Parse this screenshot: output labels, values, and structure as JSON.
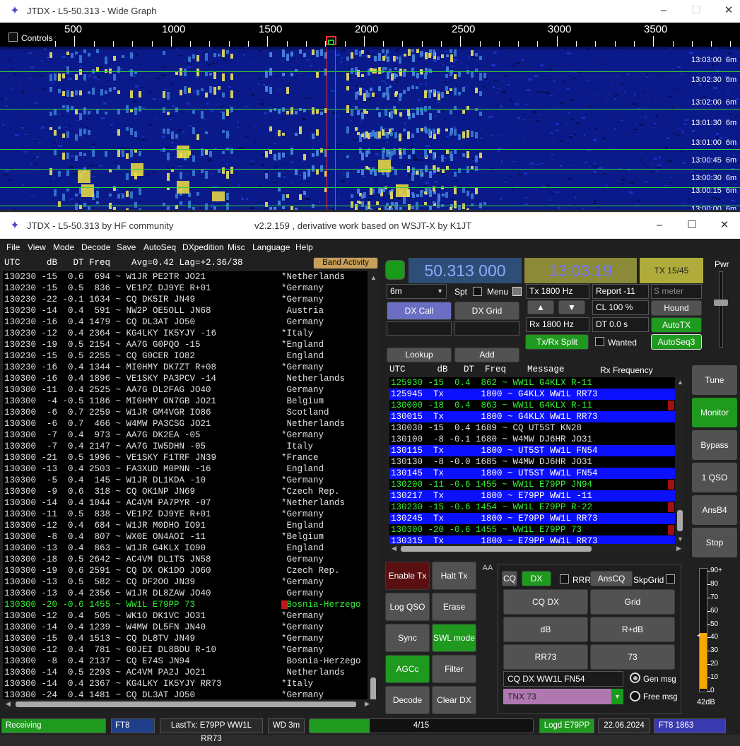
{
  "wide_graph": {
    "title": "JTDX - L5-50.313 - Wide Graph",
    "controls_label": "Controls",
    "scale_labels": [
      "500",
      "1000",
      "1500",
      "2000",
      "2500",
      "3000",
      "3500"
    ],
    "timestamps": [
      "13:03:00",
      "13:02:30",
      "13:02:00",
      "13:01:30",
      "13:01:00",
      "13:00:45",
      "13:00:30",
      "13:00:15",
      "13:00:00"
    ],
    "band_suffix": "6m"
  },
  "main_window": {
    "title": "JTDX - L5-50.313  by HF community",
    "subtitle": "v2.2.159 , derivative work based on WSJT-X by K1JT"
  },
  "menu": [
    "File",
    "View",
    "Mode",
    "Decode",
    "Save",
    "AutoSeq",
    "DXpedition",
    "Misc",
    "Language",
    "Help"
  ],
  "band_activity": {
    "header": "UTC     dB   DT Freq    Avg=0.42 Lag=+2.36/38",
    "button": "Band Activity",
    "rows": [
      {
        "t": "130230 -15  0.6  694 ~ W1JR PE2TR JO21",
        "c": "*Netherlands",
        "hl": false
      },
      {
        "t": "130230 -15  0.5  836 ~ VE1PZ DJ9YE R+01",
        "c": "*Germany",
        "hl": false
      },
      {
        "t": "130230 -22 -0.1 1634 ~ CQ DK5IR JN49",
        "c": "*Germany",
        "hl": false
      },
      {
        "t": "130230 -14  0.4  591 ~ NW2P OE5OLL JN68",
        "c": " Austria",
        "hl": false
      },
      {
        "t": "130230 -16  0.4 1479 ~ CQ DL3AT JO50",
        "c": " Germany",
        "hl": false
      },
      {
        "t": "130230 -12  0.4 2364 ~ KG4LKY IK5YJY -16",
        "c": "*Italy",
        "hl": false
      },
      {
        "t": "130230 -19  0.5 2154 ~ AA7G G0PQO -15",
        "c": "*England",
        "hl": false
      },
      {
        "t": "130230 -15  0.5 2255 ~ CQ G0CER IO82",
        "c": " England",
        "hl": false
      },
      {
        "t": "130230 -16  0.4 1344 ~ MI0HMY DK7ZT R+08",
        "c": "*Germany",
        "hl": false
      },
      {
        "t": "130300 -16  0.4 1896 ~ VE1SKY PA3PCV -14",
        "c": " Netherlands",
        "hl": false
      },
      {
        "t": "130300 -11  0.4 2525 ~ AA7G DL2FAG JO40",
        "c": " Germany",
        "hl": false
      },
      {
        "t": "130300  -4 -0.5 1186 ~ MI0HMY ON7GB JO21",
        "c": " Belgium",
        "hl": false
      },
      {
        "t": "130300  -6  0.7 2259 ~ W1JR GM4VGR IO86",
        "c": " Scotland",
        "hl": false
      },
      {
        "t": "130300  -6  0.7  466 ~ W4MW PA3CSG JO21",
        "c": " Netherlands",
        "hl": false
      },
      {
        "t": "130300  -7  0.4  973 ~ AA7G DK2EA -05",
        "c": "*Germany",
        "hl": false
      },
      {
        "t": "130300  -7  0.4 2147 ~ AA7G IW5DHN -05",
        "c": " Italy",
        "hl": false
      },
      {
        "t": "130300 -21  0.5 1996 ~ VE1SKY F1TRF JN39",
        "c": "*France",
        "hl": false
      },
      {
        "t": "130300 -13  0.4 2503 ~ FA3XUD M0PNN -16",
        "c": " England",
        "hl": false
      },
      {
        "t": "130300  -5  0.4  145 ~ W1JR DL1KDA -10",
        "c": "*Germany",
        "hl": false
      },
      {
        "t": "130300  -9  0.6  318 ~ CQ OK1NP JN69",
        "c": "*Czech Rep.",
        "hl": false
      },
      {
        "t": "130300 -14  0.4 1044 ~ AC4VM PA7PYR -07",
        "c": "*Netherlands",
        "hl": false
      },
      {
        "t": "130300 -11  0.5  838 ~ VE1PZ DJ9YE R+01",
        "c": "*Germany",
        "hl": false
      },
      {
        "t": "130300 -12  0.4  684 ~ W1JR M0DHO IO91",
        "c": " England",
        "hl": false
      },
      {
        "t": "130300  -8  0.4  807 ~ WX0E ON4AOI -11",
        "c": "*Belgium",
        "hl": false
      },
      {
        "t": "130300 -13  0.4  863 ~ W1JR G4KLX IO90",
        "c": " England",
        "hl": false
      },
      {
        "t": "130300 -18  0.5 2642 ~ AC4VM DL1TS JN58",
        "c": " Germany",
        "hl": false
      },
      {
        "t": "130300 -19  0.6 2591 ~ CQ DX OK1DO JO60",
        "c": " Czech Rep.",
        "hl": false
      },
      {
        "t": "130300 -13  0.5  582 ~ CQ DF2OO JN39",
        "c": "*Germany",
        "hl": false
      },
      {
        "t": "130300 -13  0.4 2356 ~ W1JR DL8ZAW JO40",
        "c": " Germany",
        "hl": false
      },
      {
        "t": "130300 -20 -0.6 1455 ~ WW1L E79PP 73",
        "c": "*Bosnia-Herzego",
        "hl": true
      },
      {
        "t": "130300 -12  0.4  505 ~ WK1O DK1VC JO31",
        "c": "*Germany",
        "hl": false
      },
      {
        "t": "130300 -14  0.4 1239 ~ W4MW DL5FN JN40",
        "c": "*Germany",
        "hl": false
      },
      {
        "t": "130300 -15  0.4 1513 ~ CQ DL8TV JN49",
        "c": "*Germany",
        "hl": false
      },
      {
        "t": "130300 -12  0.4  781 ~ G0JEI DL8BDU R-10",
        "c": "*Germany",
        "hl": false
      },
      {
        "t": "130300  -8  0.4 2137 ~ CQ E74S JN94",
        "c": " Bosnia-Herzego",
        "hl": false
      },
      {
        "t": "130300 -14  0.5 2293 ~ AC4VM PA2J JO21",
        "c": " Netherlands",
        "hl": false
      },
      {
        "t": "130300 -14  0.4 2367 ~ KG4LKY IK5YJY RR73",
        "c": "*Italy",
        "hl": false
      },
      {
        "t": "130300 -24  0.4 1481 ~ CQ DL3AT JO50",
        "c": "*Germany",
        "hl": false
      }
    ]
  },
  "controls": {
    "frequency": "50.313 000",
    "clock": "13:03:19",
    "tx_period": "TX 15/45",
    "band": "6m",
    "spt_label": "Spt",
    "menu_label": "Menu",
    "tx_hz": "Tx  1800  Hz",
    "rx_hz": "Rx  1800  Hz",
    "report": "Report -11",
    "s_meter": "S meter",
    "cl": "CL  100 %",
    "dt": "DT 0.0 s",
    "dx_call_btn": "DX Call",
    "dx_grid_btn": "DX Grid",
    "hound_btn": "Hound",
    "autotx_btn": "AutoTX",
    "txrx_split_btn": "Tx/Rx Split",
    "wanted_label": "Wanted",
    "autoseq3_btn": "AutoSeq3",
    "lookup_btn": "Lookup",
    "add_btn": "Add",
    "pwr_label": "Pwr"
  },
  "rx_frequency": {
    "header": "UTC      dB   DT  Freq    Message",
    "header_right": "Rx Frequency",
    "rows": [
      {
        "t": "125930 -15  0.4  862 ~ WW1L G4KLX R-11",
        "k": "g"
      },
      {
        "t": "125945  Tx       1800 ~ G4KLX WW1L RR73",
        "k": "tx"
      },
      {
        "t": "130000 -18  0.4  863 ~ WW1L G4KLX R-11",
        "k": "g"
      },
      {
        "t": "130015  Tx       1800 ~ G4KLX WW1L RR73",
        "k": "tx"
      },
      {
        "t": "130030 -15  0.4 1689 ~ CQ UT5ST KN28",
        "k": "w"
      },
      {
        "t": "130100  -8 -0.1 1680 ~ W4MW DJ6HR JO31",
        "k": "w"
      },
      {
        "t": "130115  Tx       1800 ~ UT5ST WW1L FN54",
        "k": "tx"
      },
      {
        "t": "130130  -8 -0.0 1685 ~ W4MW DJ6HR JO31",
        "k": "w"
      },
      {
        "t": "130145  Tx       1800 ~ UT5ST WW1L FN54",
        "k": "tx"
      },
      {
        "t": "130200 -11 -0.6 1455 ~ WW1L E79PP JN94",
        "k": "g"
      },
      {
        "t": "130217  Tx       1800 ~ E79PP WW1L -11",
        "k": "tx"
      },
      {
        "t": "130230 -15 -0.6 1454 ~ WW1L E79PP R-22",
        "k": "g"
      },
      {
        "t": "130245  Tx       1800 ~ E79PP WW1L RR73",
        "k": "tx"
      },
      {
        "t": "130300 -20 -0.6 1455 ~ WW1L E79PP 73",
        "k": "g"
      },
      {
        "t": "130315  Tx       1800 ~ E79PP WW1L RR73",
        "k": "tx"
      }
    ]
  },
  "side_buttons": [
    "Tune",
    "Monitor",
    "Bypass",
    "1 QSO",
    "AnsB4",
    "Stop"
  ],
  "tx_buttons": {
    "enable_tx": "Enable Tx",
    "halt_tx": "Halt Tx",
    "log_qso": "Log QSO",
    "erase": "Erase",
    "sync": "Sync",
    "swl_mode": "SWL mode",
    "agcc": "AGCc",
    "filter": "Filter",
    "decode": "Decode",
    "clear_dx": "Clear DX"
  },
  "tx_panel": {
    "cq": "CQ",
    "dx": "DX",
    "rrr": "RRR",
    "anscq": "AnsCQ",
    "skpgrid": "SkpGrid",
    "cq_dx": "CQ DX",
    "grid": "Grid",
    "db": "dB",
    "r_db": "R+dB",
    "rr73": "RR73",
    "s73": "73",
    "msg": "CQ DX WW1L FN54",
    "tnx": "TNX 73",
    "gen_msg": "Gen msg",
    "free_msg": "Free msg",
    "tab_label": "AA"
  },
  "meter": {
    "scale": [
      "90+",
      "80",
      "70",
      "60",
      "50",
      "40",
      "30",
      "20",
      "10",
      "0"
    ],
    "level_db": "42dB",
    "level_value": 42
  },
  "status": {
    "receiving": "Receiving",
    "mode": "FT8",
    "last_tx": "LastTx: E79PP WW1L RR73",
    "wd": "WD 3m",
    "progress": "4/15",
    "progress_fraction": 0.27,
    "logd": "Logd E79PP",
    "date": "22.06.2024",
    "ft8_count": "FT8  1863"
  },
  "colors": {
    "green_text": "#33ee33",
    "tx_blue": "#0b10ff",
    "freq_bg": "#2e4e78",
    "freq_fg": "#8fa8ff",
    "clock_bg": "#8a8a38"
  }
}
